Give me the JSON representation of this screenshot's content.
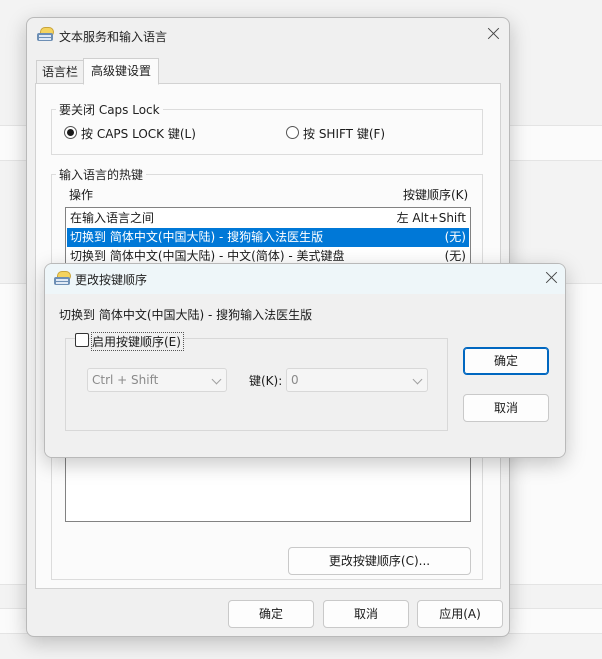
{
  "main_window": {
    "title": "文本服务和输入语言",
    "tabs": [
      {
        "label": "语言栏",
        "active": false
      },
      {
        "label": "高级键设置",
        "active": true
      }
    ],
    "caps_group": {
      "legend": "要关闭 Caps Lock",
      "option_caps": "按 CAPS LOCK 键(L)",
      "option_shift": "按 SHIFT 键(F)",
      "selected": "caps"
    },
    "hotkey_group": {
      "legend": "输入语言的热键",
      "col_action": "操作",
      "col_key": "按键顺序(K)",
      "rows": [
        {
          "action": "在输入语言之间",
          "key": "左 Alt+Shift",
          "selected": false
        },
        {
          "action": "切换到 简体中文(中国大陆) - 搜狗输入法医生版",
          "key": "(无)",
          "selected": true
        },
        {
          "action": "切换到 简体中文(中国大陆) - 中文(简体) - 美式键盘",
          "key": "(无)",
          "selected": false
        }
      ],
      "change_button": "更改按键顺序(C)..."
    },
    "buttons": {
      "ok": "确定",
      "cancel": "取消",
      "apply": "应用(A)"
    }
  },
  "dialog": {
    "title": "更改按键顺序",
    "description": "切换到 简体中文(中国大陆) - 搜狗输入法医生版",
    "enable_label": "启用按键顺序(E)",
    "enable_checked": false,
    "modifier_value": "Ctrl + Shift",
    "key_label": "键(K):",
    "key_value": "0",
    "ok": "确定",
    "cancel": "取消"
  },
  "colors": {
    "selection": "#0078d7",
    "default_button_border": "#0067c0"
  }
}
